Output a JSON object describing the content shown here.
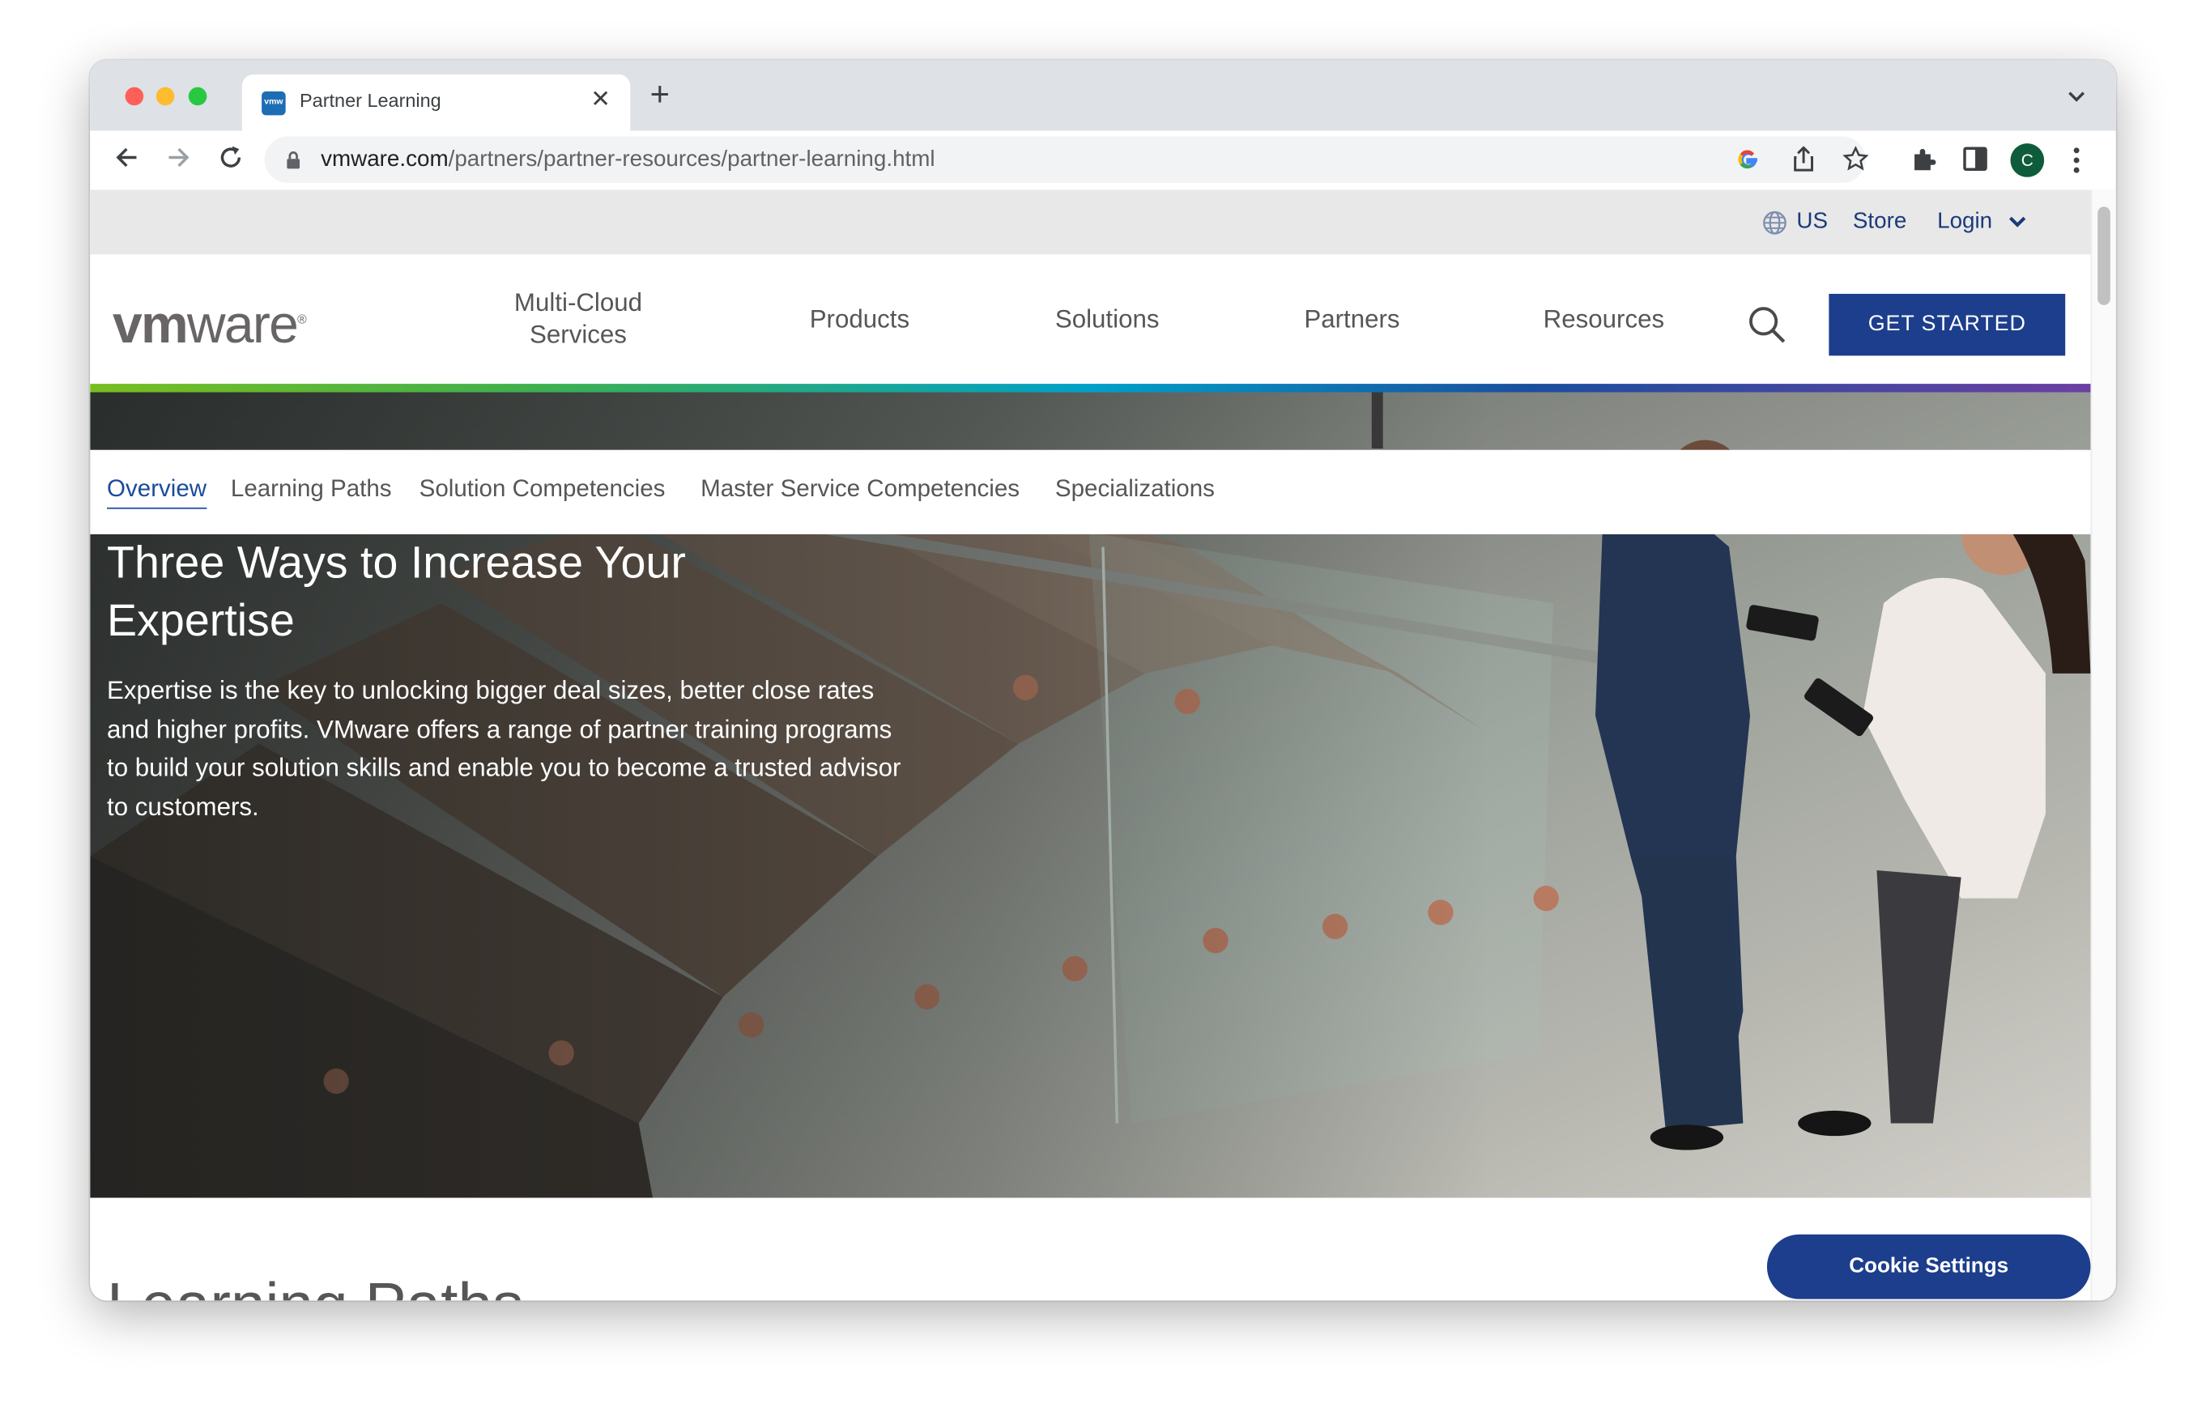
{
  "browser": {
    "tab_title": "Partner Learning",
    "favicon_text": "vmw",
    "url_domain": "vmware.com",
    "url_path": "/partners/partner-resources/partner-learning.html",
    "profile_initial": "C"
  },
  "utility_bar": {
    "region": "US",
    "store": "Store",
    "login": "Login"
  },
  "header": {
    "logo_vm": "vm",
    "logo_ware": "ware",
    "logo_mark": "®",
    "nav": {
      "multicloud_line1": "Multi-Cloud",
      "multicloud_line2": "Services",
      "products": "Products",
      "solutions": "Solutions",
      "partners": "Partners",
      "resources": "Resources"
    },
    "cta": "GET STARTED"
  },
  "subnav": {
    "overview": "Overview",
    "learning_paths": "Learning Paths",
    "solution_competencies": "Solution Competencies",
    "master_service_competencies": "Master Service Competencies",
    "specializations": "Specializations"
  },
  "hero": {
    "title": "Three Ways to Increase Your Expertise",
    "body": "Expertise is the key to unlocking bigger deal sizes, better close rates and higher profits. VMware offers a range of partner training programs to build your solution skills and enable you to become a trusted advisor to customers."
  },
  "section": {
    "title": "Learning Paths"
  },
  "cookie_button": "Cookie Settings",
  "colors": {
    "brand_blue": "#1c3e8c",
    "link_blue": "#1b4b9a"
  }
}
